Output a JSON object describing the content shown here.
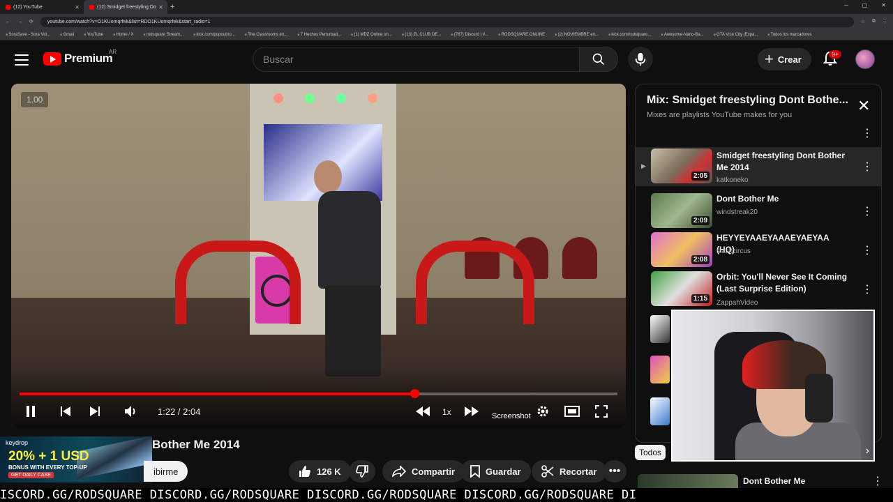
{
  "browser": {
    "tabs": [
      {
        "title": "(12) YouTube"
      },
      {
        "title": "(12) Smidget freestyling Do"
      }
    ],
    "url": "youtube.com/watch?v=O1KUomqrfek&list=RDO1KUomqrfek&start_radio=1",
    "bookmarks": [
      "SoraSave - Sora Vid...",
      "Gmail",
      "YouTube",
      "Home / X",
      "rodsquare Stream...",
      "kick.com/popout/ro...",
      "The Classrooms en...",
      "7 Hechos Perturbad...",
      "(1) MDZ Online on...",
      "(13) EL CLUB DE...",
      "(787) Discord | #...",
      "RODSQUARE.ONLINE",
      "(2) NOVIEMBRE en...",
      "kick.com/rodsquare...",
      "Awesome-Nano-Ba...",
      "GTA Vice City (Espa...",
      "Todos los marcadores"
    ]
  },
  "header": {
    "logo_text": "Premium",
    "country_code": "AR",
    "search_placeholder": "Buscar",
    "create_label": "Crear",
    "notif_count": "9+"
  },
  "player": {
    "speed_badge": "1.00",
    "time": "1:22 / 2:04",
    "progress": 0.66,
    "speed": "1x",
    "screenshot_label": "Screenshot"
  },
  "video": {
    "title_visible": "Bother Me 2014",
    "subscribe_partial": "ibirme",
    "likes": "126 K",
    "share_label": "Compartir",
    "save_label": "Guardar",
    "clip_label": "Recortar"
  },
  "ad": {
    "brand": "keydrop",
    "headline": "20% + 1 USD",
    "sub": "BONUS WITH EVERY TOP-UP",
    "cta": "GET DAILY CASE"
  },
  "playlist": {
    "title": "Mix: Smidget freestyling Dont Bothe...",
    "subtitle": "Mixes are playlists YouTube makes for you",
    "items": [
      {
        "title": "Smidget freestyling Dont Bother Me 2014",
        "channel": "katkoneko",
        "duration": "2:05"
      },
      {
        "title": "Dont Bother Me",
        "channel": "windstreak20",
        "duration": "2:09"
      },
      {
        "title": "HEYYEYAAEYAAAEYAEYAA (HQ)",
        "channel": "slackcircus",
        "duration": "2:08"
      },
      {
        "title": "Orbit: You'll Never See It Coming (Last Surprise Edition)",
        "channel": "ZappahVideo",
        "duration": "1:15"
      }
    ]
  },
  "chips": {
    "all": "Todos"
  },
  "next_rec": {
    "title": "Dont Bother Me"
  },
  "ticker": "ISCORD.GG/RODSQUARE DISCORD.GG/RODSQUARE DISCORD.GG/RODSQUARE DISCORD.GG/RODSQUARE DI"
}
